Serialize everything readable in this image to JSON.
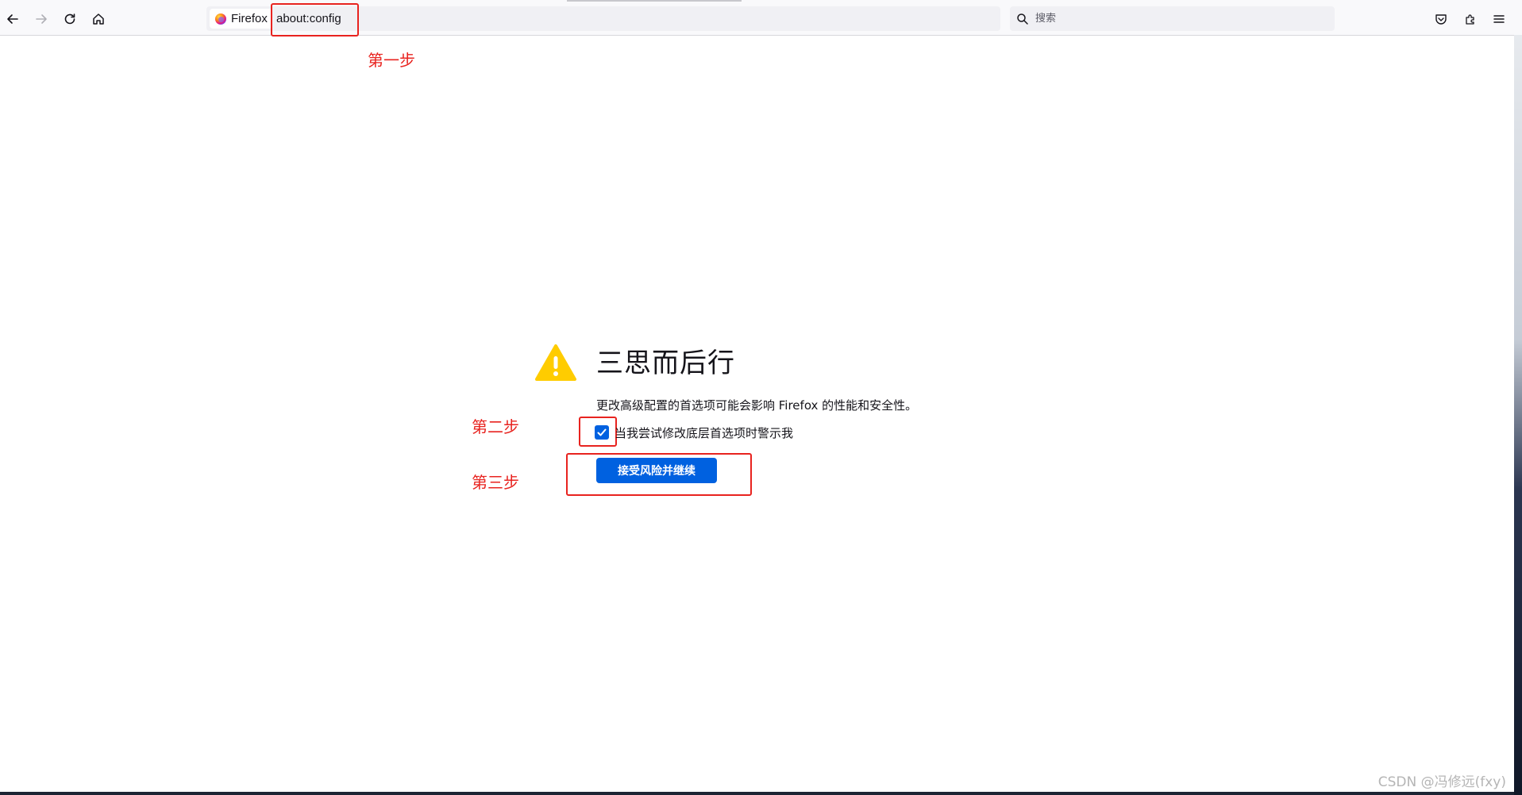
{
  "browser": {
    "identity_label": "Firefox",
    "url": "about:config",
    "search_placeholder": "搜索"
  },
  "annotations": {
    "step1": "第一步",
    "step2": "第二步",
    "step3": "第三步",
    "box_color": "#e8231f"
  },
  "warning": {
    "icon": "warning-triangle-icon",
    "title": "三思而后行",
    "description": "更改高级配置的首选项可能会影响 Firefox 的性能和安全性。",
    "checkbox_label": "当我尝试修改底层首选项时警示我",
    "checkbox_checked": true,
    "accept_button": "接受风险并继续"
  },
  "colors": {
    "accent_blue": "#0061e0",
    "warning_yellow": "#ffcc00"
  },
  "watermark": "CSDN @冯修远(fxy)"
}
